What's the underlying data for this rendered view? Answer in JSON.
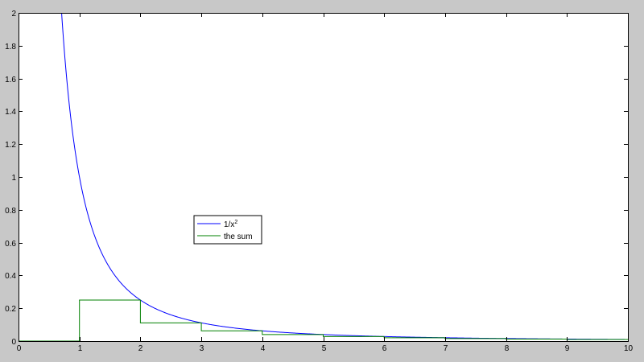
{
  "chart_data": {
    "type": "line",
    "title": "",
    "xlabel": "",
    "ylabel": "",
    "xlim": [
      0,
      10
    ],
    "ylim": [
      0,
      2
    ],
    "x_ticks": [
      0,
      1,
      2,
      3,
      4,
      5,
      6,
      7,
      8,
      9,
      10
    ],
    "y_ticks": [
      0,
      0.2,
      0.4,
      0.6,
      0.8,
      1,
      1.2,
      1.4,
      1.6,
      1.8,
      2
    ],
    "x_tick_labels": [
      "0",
      "1",
      "2",
      "3",
      "4",
      "5",
      "6",
      "7",
      "8",
      "9",
      "10"
    ],
    "y_tick_labels": [
      "0",
      "0.2",
      "0.4",
      "0.6",
      "0.8",
      "1",
      "1.2",
      "1.4",
      "1.6",
      "1.8",
      "2"
    ],
    "grid": false,
    "legend_position": "center-left",
    "series": [
      {
        "name": "1/x",
        "name_superscript": "2",
        "color": "#0000ff",
        "function": "1/x^2",
        "x_range": [
          0.7,
          10
        ]
      },
      {
        "name": "the sum",
        "color": "#008000",
        "step": true,
        "x": [
          0,
          1,
          1,
          2,
          2,
          3,
          3,
          4,
          4,
          5,
          5,
          6,
          6,
          7,
          7,
          8,
          8,
          9,
          9,
          10
        ],
        "y": [
          0,
          0,
          0.25,
          0.25,
          0.1111,
          0.1111,
          0.0625,
          0.0625,
          0.04,
          0.04,
          0.0278,
          0.0278,
          0.0204,
          0.0204,
          0.0156,
          0.0156,
          0.0123,
          0.0123,
          0.01,
          0.01
        ]
      }
    ]
  },
  "colors": {
    "figure_background": "#c8c8c8",
    "axes_background": "#ffffff",
    "axes_border": "#000000"
  }
}
